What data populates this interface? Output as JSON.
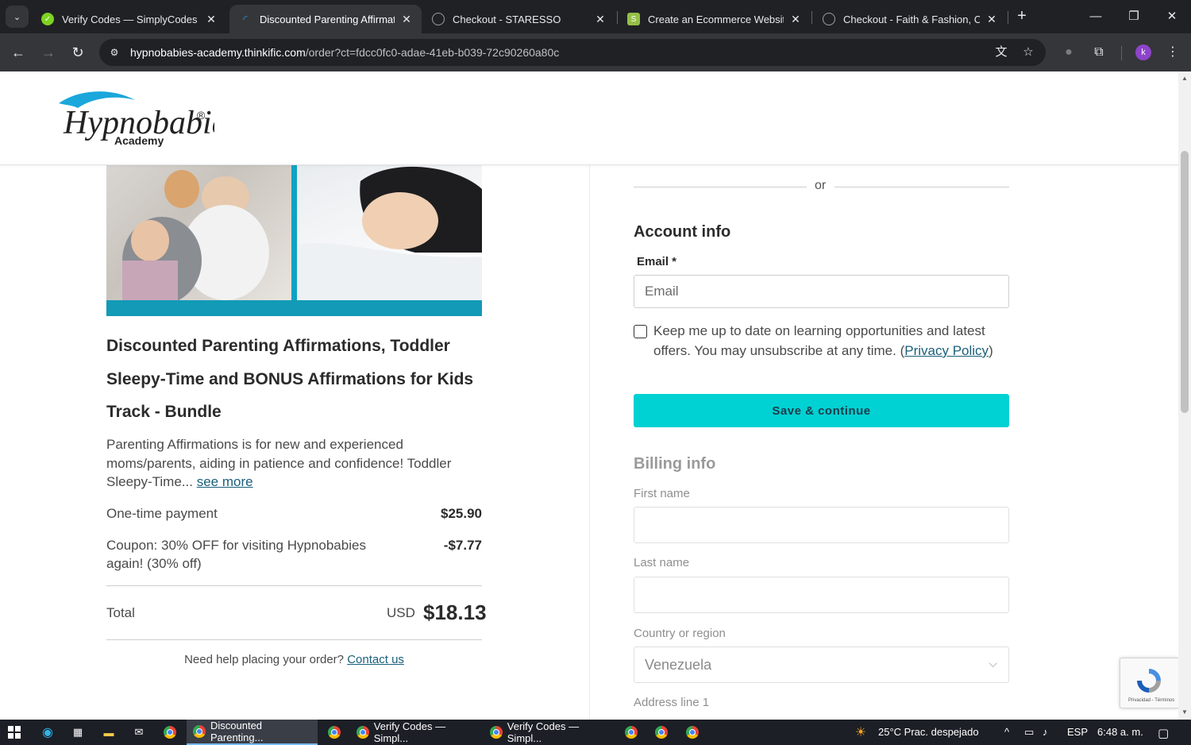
{
  "browser": {
    "tabs": [
      {
        "title": "Verify Codes — SimplyCodes",
        "favicon_color": "#7ed321"
      },
      {
        "title": "Discounted Parenting Affirmatio",
        "favicon_color": "#1ba1e2"
      },
      {
        "title": "Checkout - STARESSO",
        "favicon_color": "#9aa0a6"
      },
      {
        "title": "Create an Ecommerce Website",
        "favicon_color": "#95bf47"
      },
      {
        "title": "Checkout - Faith & Fashion, Co",
        "favicon_color": "#9aa0a6"
      }
    ],
    "url_host": "hypnobabies-academy.thinkific.com",
    "url_path": "/order?ct=fdcc0fc0-adae-41eb-b039-72c90260a80c",
    "profile_initial": "k"
  },
  "site": {
    "logo_main": "Hypnobabies",
    "logo_sub": "Academy",
    "logo_mark": "®"
  },
  "product": {
    "title": "Discounted Parenting Affirmations, Toddler Sleepy-Time and BONUS Affirmations for Kids Track - Bundle",
    "description": "Parenting Affirmations is for new and experienced moms/parents, aiding in patience and confidence! Toddler Sleepy-Time...",
    "see_more": "see more",
    "payment_label": "One-time payment",
    "payment_value": "$25.90",
    "coupon_label": "Coupon: 30% OFF for visiting Hypnobabies again! (30% off)",
    "coupon_value": "-$7.77",
    "total_label": "Total",
    "total_currency": "USD",
    "total_value": "$18.13",
    "help_text": "Need help placing your order?",
    "help_link": "Contact us"
  },
  "form": {
    "or": "or",
    "account_heading": "Account info",
    "email_label": "Email *",
    "email_placeholder": "Email",
    "newsletter_text": "Keep me up to date on learning opportunities and latest offers. You may unsubscribe at any time.",
    "privacy_link": "Privacy Policy",
    "save_button": "Save & continue",
    "billing_heading": "Billing info",
    "first_name_label": "First name",
    "last_name_label": "Last name",
    "country_label": "Country or region",
    "country_value": "Venezuela",
    "address_label": "Address line 1",
    "accent_color": "#00d1d3"
  },
  "recaptcha": {
    "footer": "Privacidad - Términos"
  },
  "taskbar": {
    "apps": [
      {
        "label": "Discounted Parenting..."
      },
      {
        "label": "Verify Codes — Simpl..."
      },
      {
        "label": "Verify Codes — Simpl..."
      }
    ],
    "weather": "25°C  Prac. despejado",
    "language": "ESP",
    "time": "6:48 a. m."
  }
}
